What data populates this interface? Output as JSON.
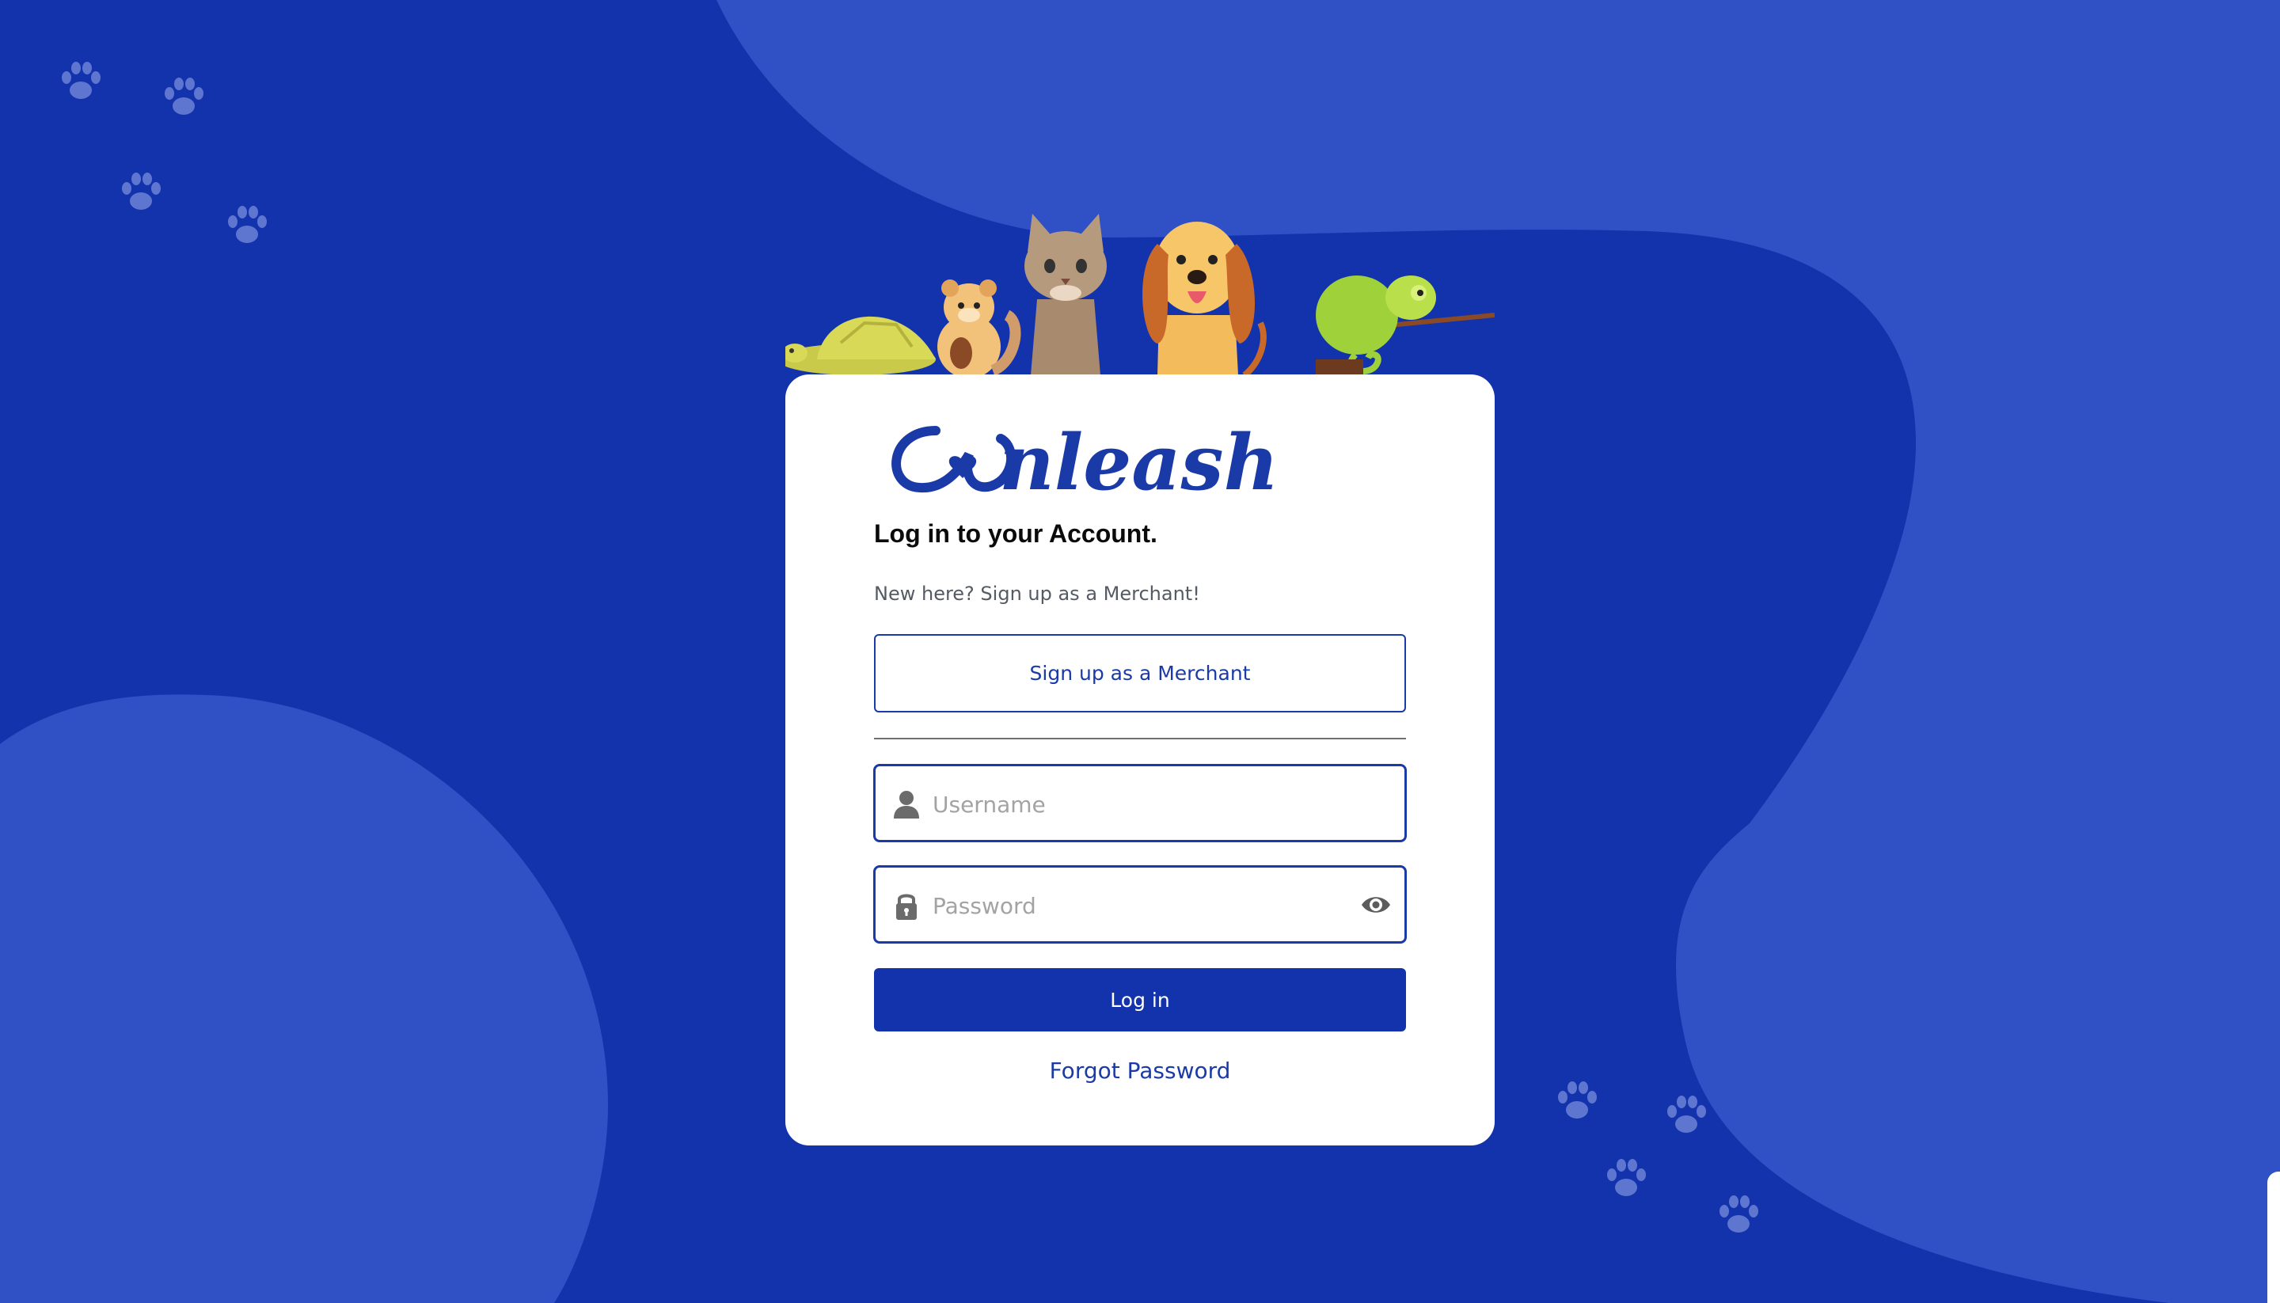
{
  "colors": {
    "background": "#1333ad",
    "blob": "#3050c6",
    "paw": "#5e76d0",
    "primary": "#1a3aa8",
    "card": "#ffffff"
  },
  "brand": {
    "logo_text": "Unleash"
  },
  "header": {
    "title": "Log in to your Account.",
    "subtitle": "New here? Sign up as a Merchant!"
  },
  "signup": {
    "label": "Sign up as a Merchant"
  },
  "form": {
    "username": {
      "placeholder": "Username",
      "value": "",
      "icon": "user-icon"
    },
    "password": {
      "placeholder": "Password",
      "value": "",
      "icon": "lock-icon",
      "toggle_icon": "eye-icon"
    },
    "login_label": "Log in",
    "forgot_label": "Forgot Password"
  },
  "illustration": {
    "animals": [
      "turtle-icon",
      "hamster-icon",
      "cat-icon",
      "dog-icon",
      "chameleon-icon"
    ]
  }
}
